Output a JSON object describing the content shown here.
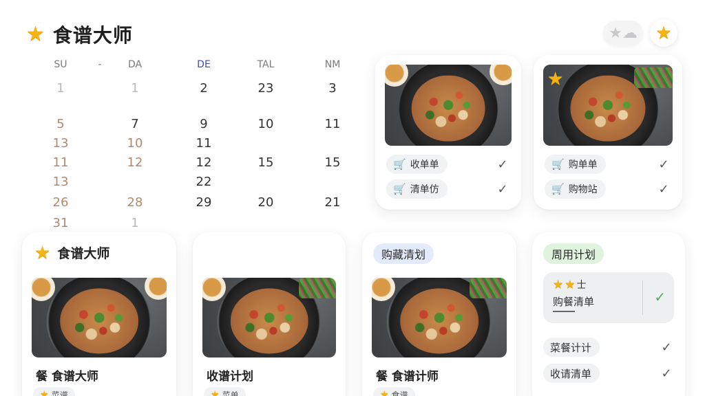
{
  "app": {
    "title": "食谱大师"
  },
  "header": {
    "ghost_icon": "star-cloud-icon",
    "star_icon": "star-icon"
  },
  "calendar": {
    "columns": [
      {
        "head": "SU",
        "cells": [
          {
            "v": "1",
            "c": "muted",
            "r": 1
          },
          {
            "v": "5",
            "c": "warm",
            "r": 3
          },
          {
            "v": "13",
            "c": "warm",
            "r": 4
          },
          {
            "v": "11",
            "c": "warm",
            "r": 5
          },
          {
            "v": "13",
            "c": "warm",
            "r": 6
          },
          {
            "v": "26",
            "c": "warm",
            "r": 7
          },
          {
            "v": "31",
            "c": "warm",
            "r": 8
          }
        ]
      },
      {
        "head": "-",
        "cells": []
      },
      {
        "head": "DA",
        "cells": [
          {
            "v": "1",
            "c": "muted",
            "r": 1
          },
          {
            "v": "7",
            "c": "",
            "r": 3
          },
          {
            "v": "10",
            "c": "warm",
            "r": 4
          },
          {
            "v": "12",
            "c": "warm",
            "r": 5
          },
          {
            "v": "28",
            "c": "warm",
            "r": 7
          },
          {
            "v": "1",
            "c": "muted",
            "r": 8
          }
        ]
      },
      {
        "head": "DE",
        "cells": [
          {
            "v": "2",
            "c": "",
            "r": 1
          },
          {
            "v": "9",
            "c": "",
            "r": 3
          },
          {
            "v": "11",
            "c": "",
            "r": 4
          },
          {
            "v": "12",
            "c": "",
            "r": 5
          },
          {
            "v": "22",
            "c": "",
            "r": 6
          },
          {
            "v": "29",
            "c": "",
            "r": 7
          }
        ]
      },
      {
        "head": "TAL",
        "cells": [
          {
            "v": "23",
            "c": "",
            "r": 1
          },
          {
            "v": "10",
            "c": "",
            "r": 3
          },
          {
            "v": "15",
            "c": "",
            "r": 5
          },
          {
            "v": "20",
            "c": "",
            "r": 7
          }
        ]
      },
      {
        "head": "NM",
        "cells": [
          {
            "v": "3",
            "c": "",
            "r": 1
          },
          {
            "v": "11",
            "c": "",
            "r": 3
          },
          {
            "v": "15",
            "c": "",
            "r": 5
          },
          {
            "v": "21",
            "c": "",
            "r": 7
          }
        ]
      }
    ]
  },
  "top_cards": [
    {
      "rows": [
        {
          "label": "收单单",
          "icon": "cart-icon"
        },
        {
          "label": "清单仿",
          "icon": "cart-icon"
        }
      ],
      "has_star": false
    },
    {
      "rows": [
        {
          "label": "购单单",
          "icon": "cart-icon"
        },
        {
          "label": "购物站",
          "icon": "cart-icon"
        }
      ],
      "has_star": true
    }
  ],
  "bottom_cards": [
    {
      "kind": "title",
      "title": "食谱大师",
      "caption": "餐 食谱大师",
      "mini": "菜谱"
    },
    {
      "kind": "plain",
      "caption": "收谱计划",
      "mini": "菜单"
    },
    {
      "kind": "tag",
      "tag": "购藏清划",
      "tag_color": "blue",
      "caption": "餐 食谱计师",
      "mini": "食谱"
    }
  ],
  "plan_card": {
    "tag": "周用计划",
    "box": {
      "stars_suffix": "士",
      "text": "购餐清单"
    },
    "rows": [
      {
        "label": "菜餐计计"
      },
      {
        "label": "收请清单"
      }
    ]
  }
}
